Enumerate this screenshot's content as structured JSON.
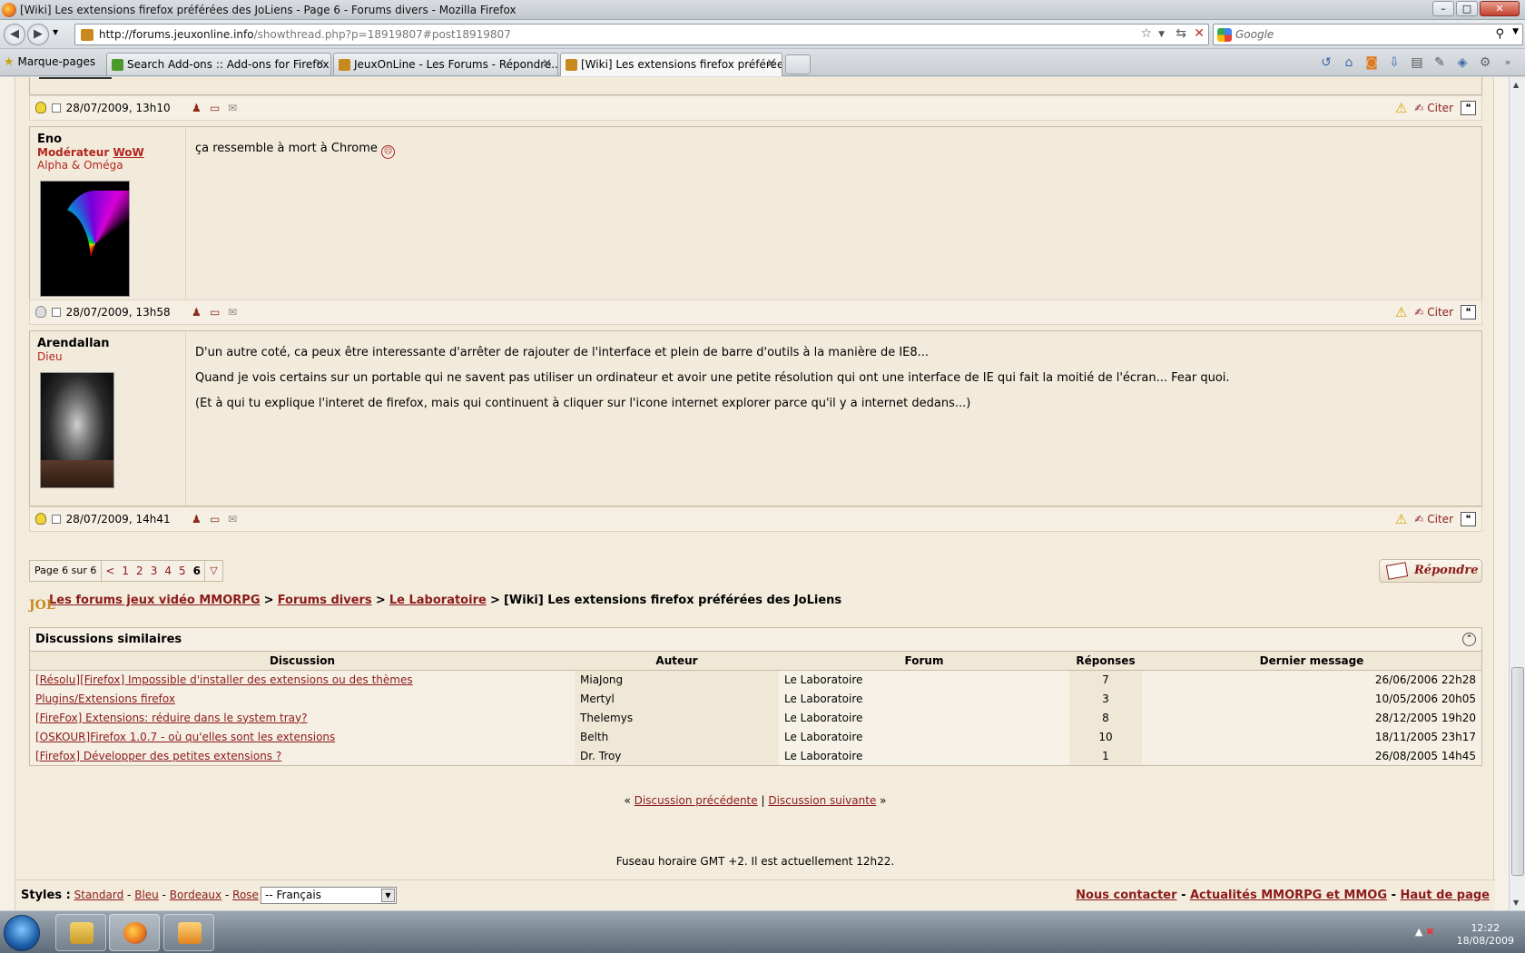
{
  "window": {
    "title": "[Wiki] Les extensions firefox préférées des JoLiens - Page 6 - Forums divers - Mozilla Firefox"
  },
  "nav": {
    "url_host": "http://forums.jeuxonline.info",
    "url_path": "/showthread.php?p=18919807#post18919807",
    "search_placeholder": "Google"
  },
  "bookmarks_label": "Marque-pages",
  "tabs": [
    {
      "label": "Search Add-ons :: Add-ons for Firefox",
      "color": "#4a9a2a"
    },
    {
      "label": "JeuxOnLine - Les Forums - Répondre...",
      "color": "#c88a1e"
    },
    {
      "label": "[Wiki] Les extensions firefox préférée...",
      "color": "#c88a1e"
    }
  ],
  "posts": [
    {
      "footer_date": "28/07/2009, 13h10",
      "bulb": "on"
    },
    {
      "user": "Eno",
      "rank_bold": "Modérateur",
      "rank_link": "WoW",
      "title": "Alpha & Oméga",
      "message": [
        "ça ressemble à mort à Chrome"
      ],
      "footer_date": "28/07/2009, 13h58",
      "bulb": "off"
    },
    {
      "user": "Arendallan",
      "title": "Dieu",
      "message": [
        "D'un autre coté, ca peux être interessante d'arrêter de rajouter de l'interface et plein de barre d'outils à la manière de IE8...",
        "Quand je vois certains sur un portable qui ne savent pas utiliser un ordinateur et avoir une petite résolution qui ont une interface de IE qui fait la moitié de l'écran... Fear quoi.",
        "(Et à qui tu explique l'interet de firefox, mais qui continuent à cliquer sur l'icone internet explorer parce qu'il y a internet dedans...)"
      ],
      "footer_date": "28/07/2009, 14h41",
      "bulb": "on"
    }
  ],
  "post_actions": {
    "quote": "Citer"
  },
  "pager": {
    "label": "Page 6 sur 6",
    "prev": "<",
    "pages": [
      "1",
      "2",
      "3",
      "4",
      "5"
    ],
    "current": "6"
  },
  "reply_label": "Répondre",
  "breadcrumb": {
    "logo": "JOL",
    "sep": ">",
    "items": [
      "Les forums jeux vidéo MMORPG",
      "Forums divers",
      "Le Laboratoire"
    ],
    "current": "[Wiki] Les extensions firefox préférées des JoLiens"
  },
  "similar": {
    "title": "Discussions similaires",
    "headers": [
      "Discussion",
      "Auteur",
      "Forum",
      "Réponses",
      "Dernier message"
    ],
    "rows": [
      [
        "[Résolu][Firefox] Impossible d'installer des extensions ou des thèmes",
        "MiaJong",
        "Le Laboratoire",
        "7",
        "26/06/2006 22h28"
      ],
      [
        "Plugins/Extensions firefox",
        "Mertyl",
        "Le Laboratoire",
        "3",
        "10/05/2006 20h05"
      ],
      [
        "[FireFox] Extensions: réduire dans le system tray?",
        "Thelemys",
        "Le Laboratoire",
        "8",
        "28/12/2005 19h20"
      ],
      [
        "[OSKOUR]Firefox 1.0.7 - où qu'elles sont les extensions",
        "Belth",
        "Le Laboratoire",
        "10",
        "18/11/2005 23h17"
      ],
      [
        "[Firefox] Développer des petites extensions ?",
        "Dr. Troy",
        "Le Laboratoire",
        "1",
        "26/08/2005 14h45"
      ]
    ]
  },
  "thread_nav": {
    "open": "«",
    "prev": "Discussion précédente",
    "sep": "|",
    "next": "Discussion suivante",
    "close": "»"
  },
  "timezone": "Fuseau horaire GMT +2. Il est actuellement 12h22.",
  "footer": {
    "styles_label": "Styles :",
    "styles": [
      "Standard",
      "Bleu",
      "Bordeaux",
      "Rose"
    ],
    "style_sep": "-",
    "language": "-- Français",
    "links": [
      "Nous contacter",
      "Actualités MMORPG et MMOG",
      "Haut de page"
    ],
    "link_sep": "-"
  },
  "taskbar": {
    "time": "12:22",
    "date": "18/08/2009"
  }
}
